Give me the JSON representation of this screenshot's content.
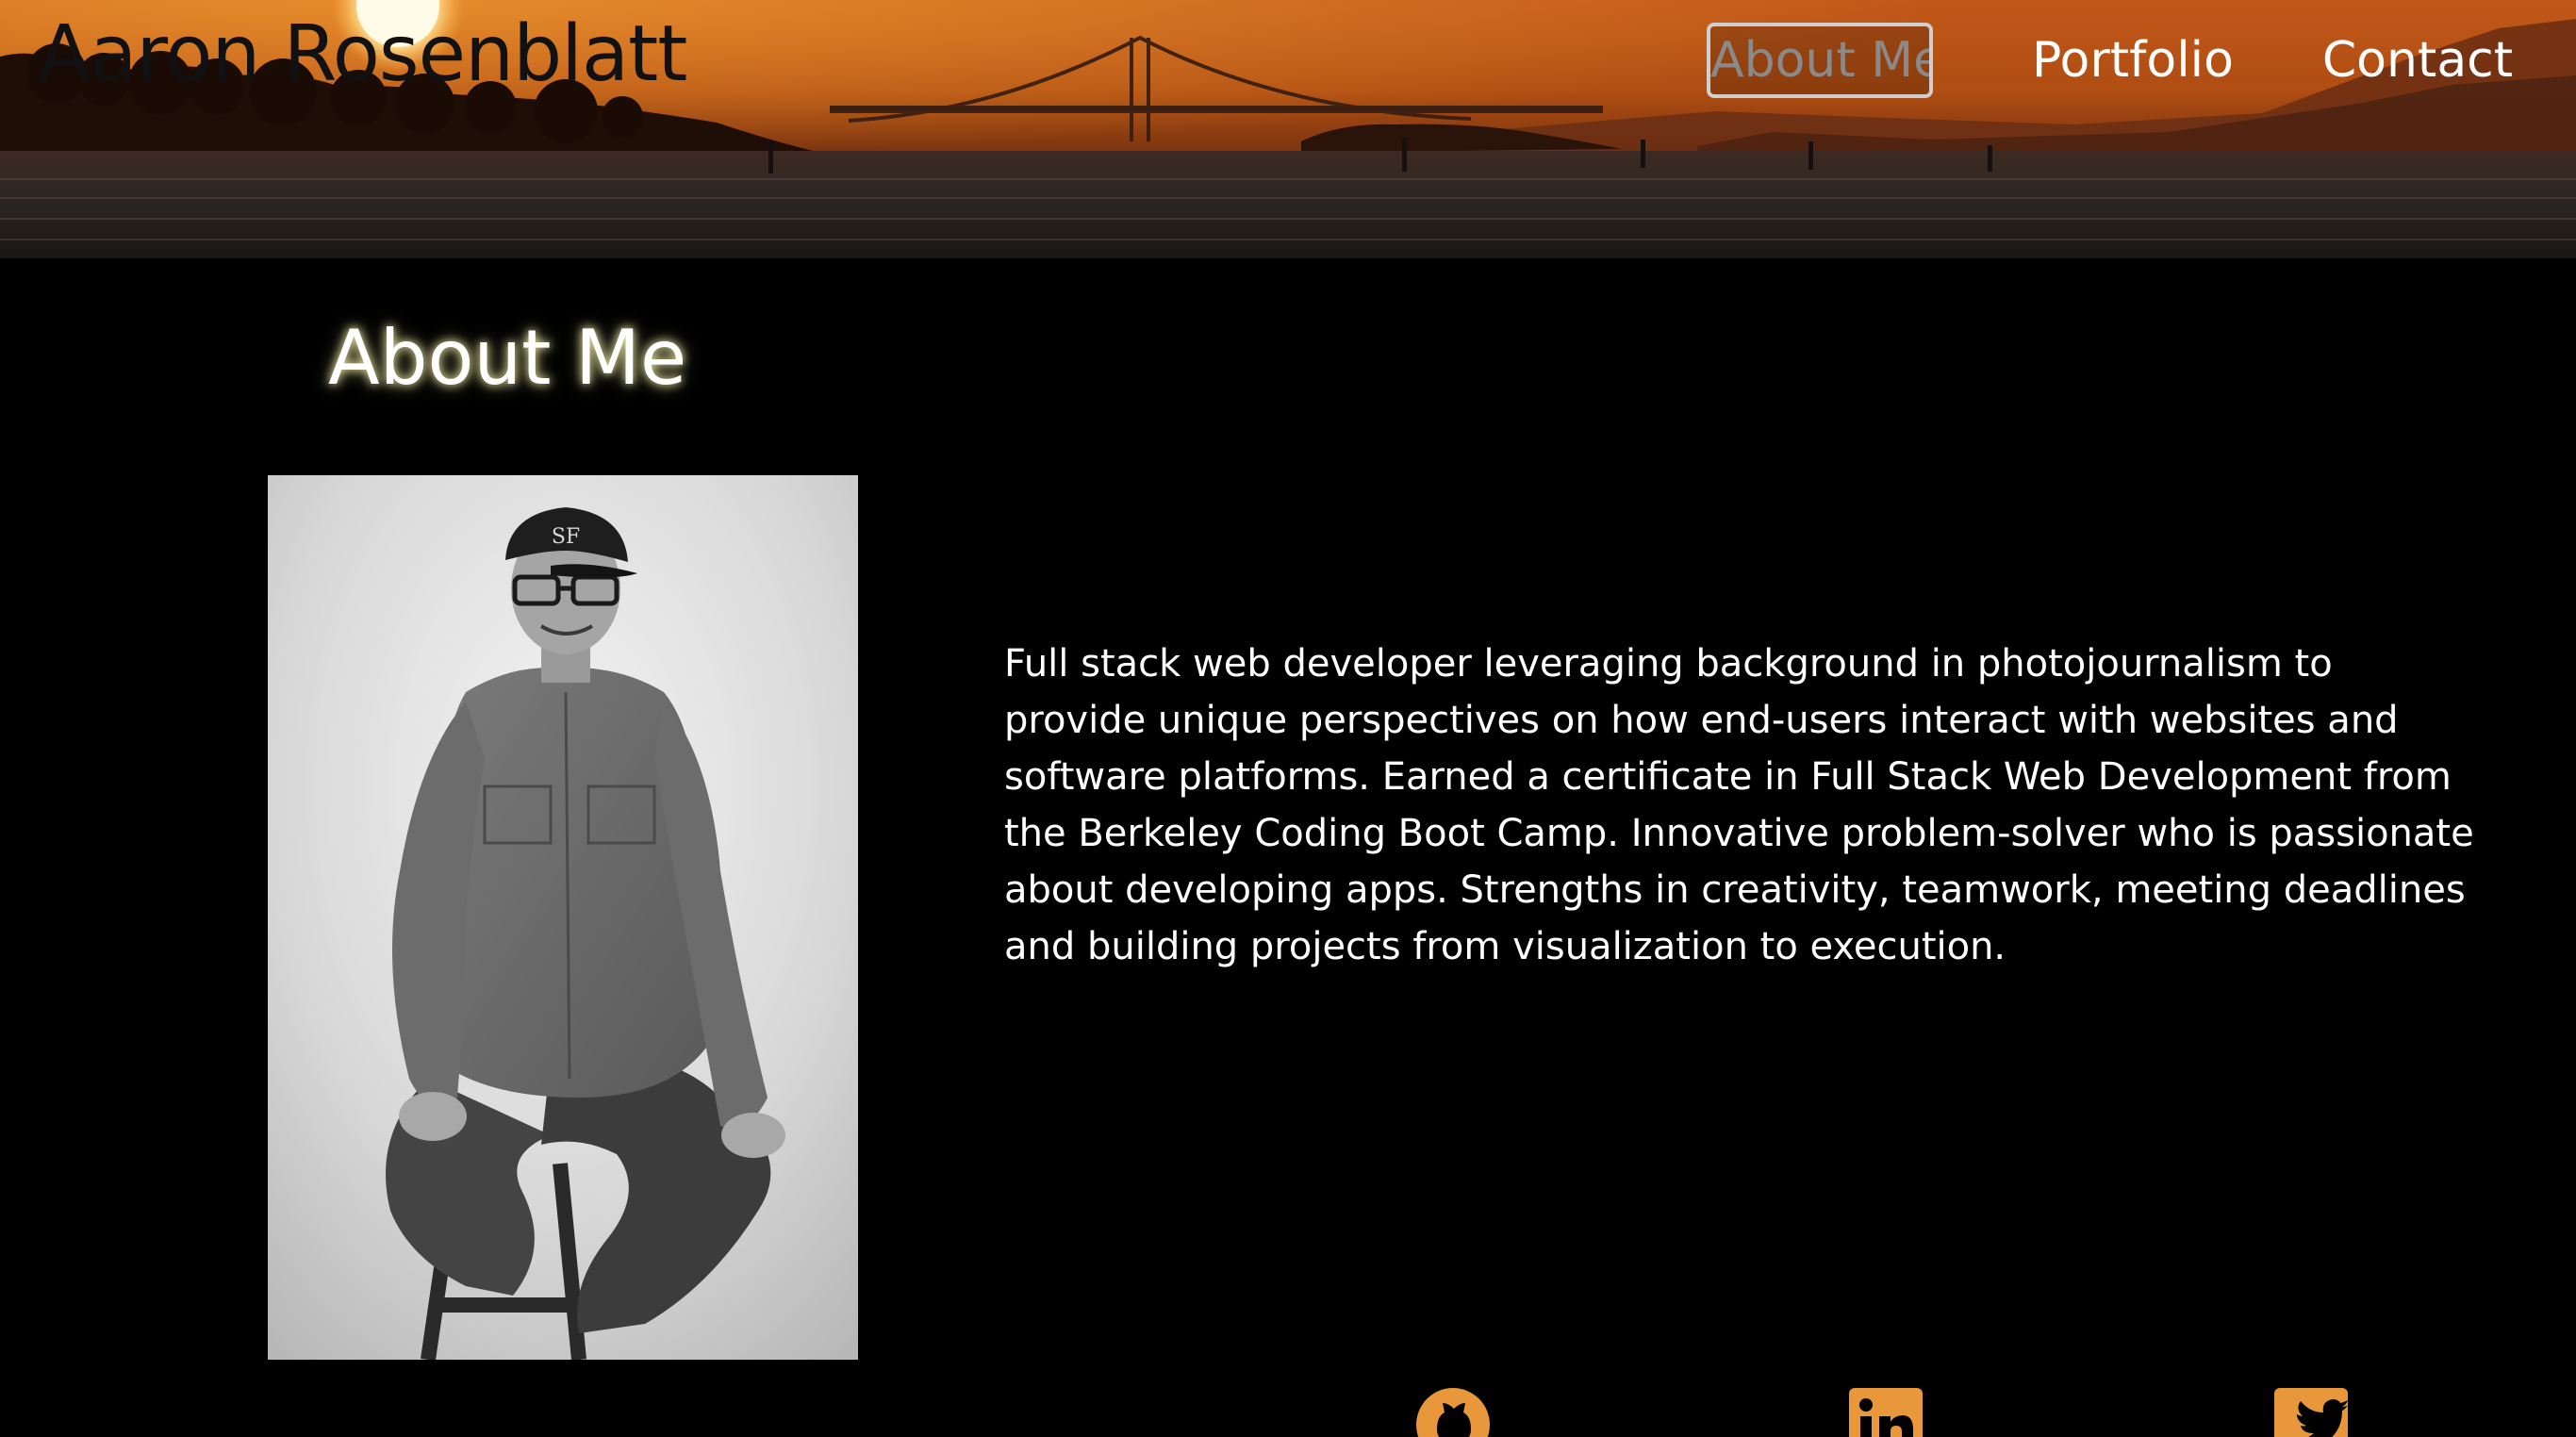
{
  "header": {
    "site_name": "Aaron Rosenblatt",
    "nav": [
      {
        "label": "About Me",
        "active": true
      },
      {
        "label": "Portfolio",
        "active": false
      },
      {
        "label": "Contact",
        "active": false
      }
    ],
    "hero_image": "sunset-over-golden-gate-bridge"
  },
  "about": {
    "title": "About Me",
    "portrait": "black-and-white-portrait-seated-on-stool",
    "bio": "Full stack web developer leveraging background in photojournalism to provide unique perspectives on how end-users interact with websites and software platforms. Earned a certificate in Full Stack Web Development from the Berkeley Coding Boot Camp. Innovative problem-solver who is passionate about developing apps. Strengths in creativity, teamwork, meeting deadlines and building projects from visualization to execution."
  },
  "social": [
    {
      "icon": "github-icon"
    },
    {
      "icon": "linkedin-icon"
    },
    {
      "icon": "twitter-icon"
    }
  ],
  "colors": {
    "background": "#000000",
    "accent": "#e8973a",
    "title_glow": "#f7f2a8",
    "text": "#ffffff"
  }
}
